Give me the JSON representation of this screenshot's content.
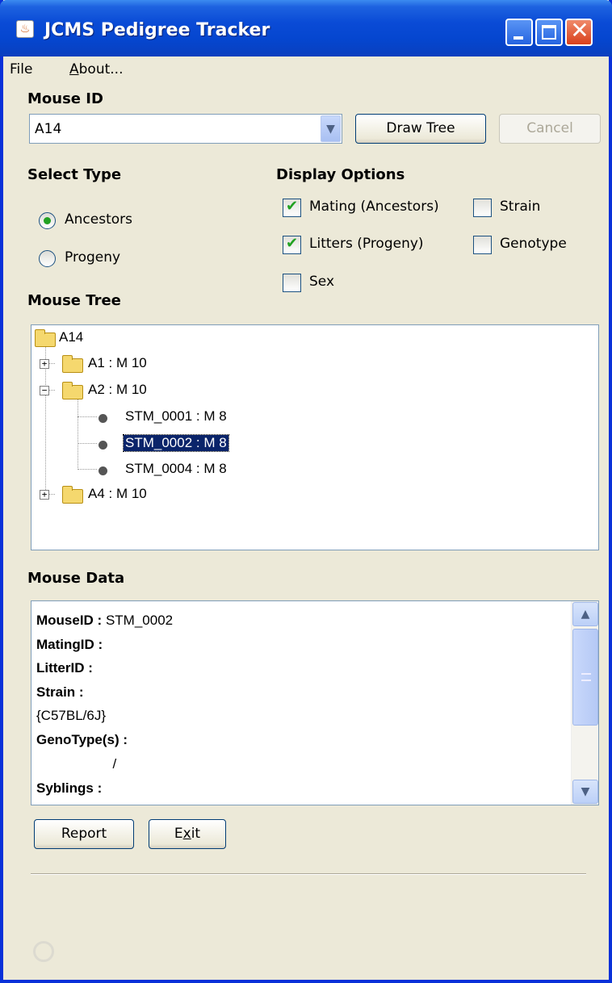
{
  "window": {
    "title": "JCMS Pedigree Tracker",
    "close_glyph": "✕"
  },
  "menu": {
    "file": "File",
    "about_first": "A",
    "about_rest": "bout..."
  },
  "mouse_id": {
    "label": "Mouse ID",
    "value": "A14",
    "draw_button": "Draw Tree",
    "cancel_button": "Cancel"
  },
  "select_type": {
    "label": "Select Type",
    "options": [
      {
        "label": "Ancestors",
        "selected": true
      },
      {
        "label": "Progeny",
        "selected": false
      }
    ]
  },
  "display_options": {
    "label": "Display Options",
    "items": [
      {
        "label": "Mating (Ancestors)",
        "checked": true
      },
      {
        "label": "Strain",
        "checked": false
      },
      {
        "label": "Litters (Progeny)",
        "checked": true
      },
      {
        "label": "Genotype",
        "checked": false
      },
      {
        "label": "Sex",
        "checked": false
      }
    ]
  },
  "tree": {
    "label": "Mouse Tree",
    "nodes": [
      {
        "label": "A14",
        "type": "folder",
        "expander": ""
      },
      {
        "label": "A1 : M 10",
        "type": "folder",
        "expander": "+"
      },
      {
        "label": "A2 : M 10",
        "type": "folder",
        "expander": "−"
      },
      {
        "label": "STM_0001 : M 8",
        "type": "leaf",
        "selected": false
      },
      {
        "label": "STM_0002 : M 8",
        "type": "leaf",
        "selected": true
      },
      {
        "label": "STM_0004 : M 8",
        "type": "leaf",
        "selected": false
      },
      {
        "label": "A4 : M 10",
        "type": "folder",
        "expander": "+"
      }
    ]
  },
  "mouse_data": {
    "label": "Mouse Data",
    "lines": [
      {
        "key": "MouseID :",
        "value": " STM_0002"
      },
      {
        "key": "MatingID :",
        "value": ""
      },
      {
        "key": "LitterID :",
        "value": ""
      },
      {
        "key": "Strain :",
        "value": ""
      },
      {
        "key": "",
        "value": "{C57BL/6J}"
      },
      {
        "key": "GenoType(s) :",
        "value": ""
      },
      {
        "key": "",
        "value": "                    /"
      },
      {
        "key": "Syblings :",
        "value": ""
      }
    ]
  },
  "buttons": {
    "report": "Report",
    "exit_first": "E",
    "exit_mnemonic": "x",
    "exit_rest": "it"
  },
  "colors": {
    "titlebar": "#0546cf",
    "window_bg": "#ece9d8",
    "selection": "#0a246a",
    "check_green": "#21a121"
  }
}
